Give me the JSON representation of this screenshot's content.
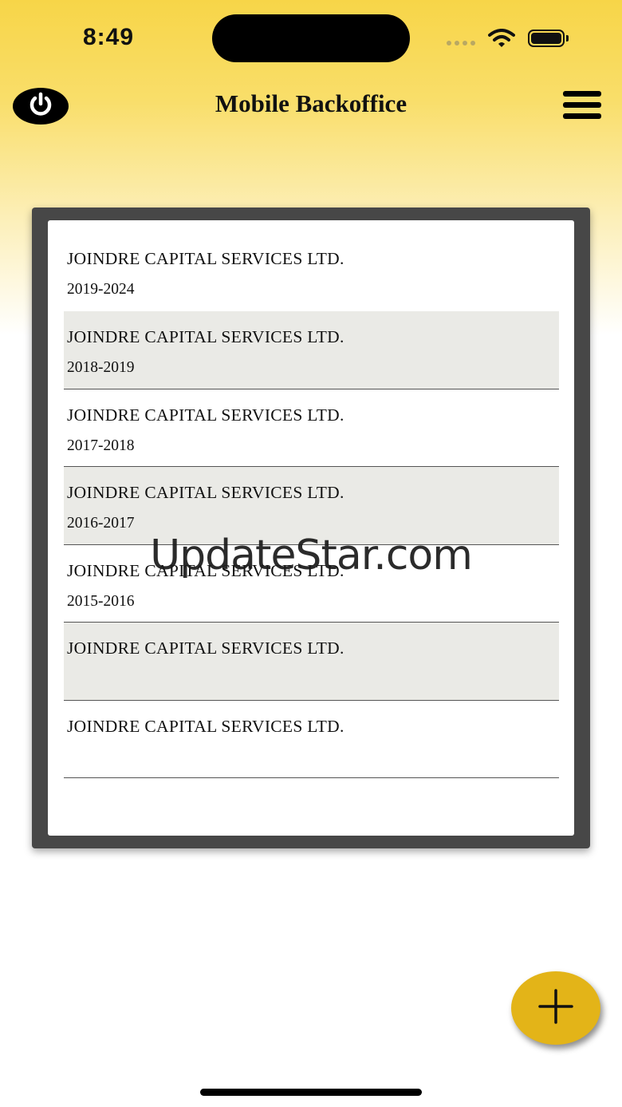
{
  "status_bar": {
    "time": "8:49"
  },
  "header": {
    "title": "Mobile Backoffice",
    "left_icon": "power-icon",
    "right_icon": "hamburger-menu-icon"
  },
  "companies": [
    {
      "name": "JOINDRE CAPITAL SERVICES LTD.",
      "years": "2019-2024"
    },
    {
      "name": "JOINDRE CAPITAL SERVICES LTD.",
      "years": "2018-2019"
    },
    {
      "name": "JOINDRE CAPITAL SERVICES LTD.",
      "years": "2017-2018"
    },
    {
      "name": "JOINDRE CAPITAL SERVICES LTD.",
      "years": "2016-2017"
    },
    {
      "name": "JOINDRE CAPITAL SERVICES LTD.",
      "years": "2015-2016"
    },
    {
      "name": "JOINDRE CAPITAL SERVICES LTD.",
      "years": ""
    },
    {
      "name": "JOINDRE CAPITAL SERVICES LTD.",
      "years": ""
    }
  ],
  "watermark": "UpdateStar.com",
  "fab": {
    "icon": "plus-icon"
  },
  "colors": {
    "accent": "#e3b418",
    "header_gradient_top": "#f7d548",
    "panel_border": "#474747",
    "shaded_row": "#eaeae6"
  }
}
